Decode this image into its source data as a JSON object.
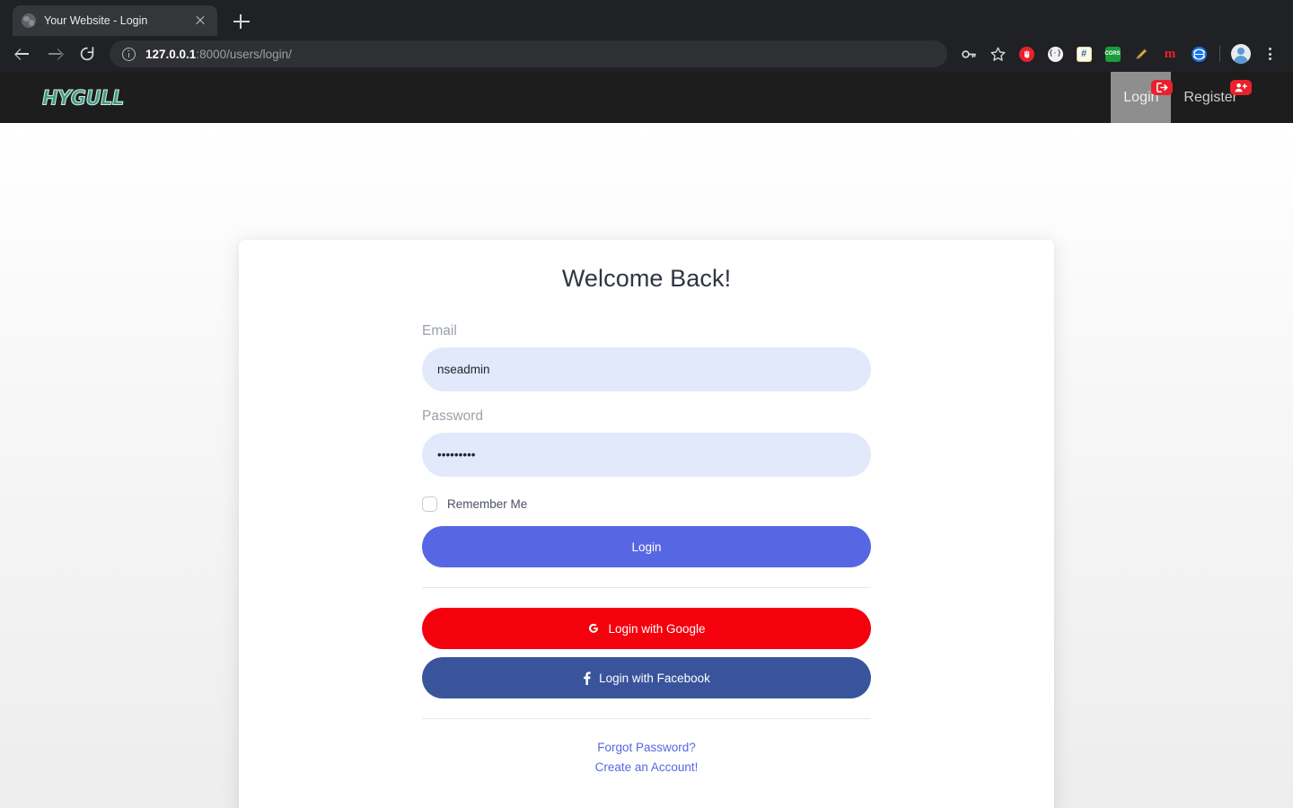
{
  "browser": {
    "tab": {
      "title": "Your Website - Login",
      "favicon": "globe-icon",
      "close": "close-icon"
    },
    "new_tab": "+",
    "nav": {
      "back": "back-arrow-icon",
      "forward": "forward-arrow-icon",
      "reload": "reload-icon"
    },
    "url": {
      "host": "127.0.0.1",
      "path": ":8000/users/login/",
      "security": "info-icon"
    },
    "toolbar_icons": [
      {
        "name": "password-key-icon",
        "glyph": "⚷",
        "color": "#d2d4d7",
        "bg": "transparent"
      },
      {
        "name": "bookmark-star-icon",
        "glyph": "☆",
        "color": "#d2d4d7",
        "bg": "transparent"
      },
      {
        "name": "ublock-origin-extension-icon",
        "glyph": "✋",
        "color": "#ffffff",
        "bg": "#e8212c"
      },
      {
        "name": "json-viewer-extension-icon",
        "glyph": "{·}",
        "color": "#3c3c3c",
        "bg": "#f1f1f1"
      },
      {
        "name": "notes-extension-icon",
        "glyph": "#",
        "color": "#2b6cb0",
        "bg": "#fdf6d8"
      },
      {
        "name": "cors-extension-icon",
        "glyph": "CORS",
        "color": "#ffffff",
        "bg": "#1a9c3c"
      },
      {
        "name": "marker-pen-extension-icon",
        "glyph": "✎",
        "color": "#e8a33d",
        "bg": "transparent"
      },
      {
        "name": "momentum-extension-icon",
        "glyph": "m",
        "color": "#e8212c",
        "bg": "transparent"
      },
      {
        "name": "globe-extension-icon",
        "glyph": "❄",
        "color": "#ffffff",
        "bg": "#1a73e8"
      }
    ],
    "profile": "profile-avatar-icon",
    "menu": "chrome-menu-icon"
  },
  "site_header": {
    "brand": "HYGULL",
    "nav_items": [
      {
        "label": "Login",
        "active": true,
        "badge_icon": "sign-in-icon"
      },
      {
        "label": "Register",
        "active": false,
        "badge_icon": "user-plus-icon"
      }
    ]
  },
  "login_card": {
    "title": "Welcome Back!",
    "email": {
      "label": "Email",
      "value": "nseadmin",
      "placeholder": "Email"
    },
    "password": {
      "label": "Password",
      "value": "•••••••••",
      "placeholder": "Password"
    },
    "remember_me": {
      "label": "Remember Me",
      "checked": false
    },
    "submit_button": "Login",
    "social": [
      {
        "label": "Login with Google",
        "icon": "google-g-icon",
        "color": "#f5010d"
      },
      {
        "label": "Login with Facebook",
        "icon": "facebook-f-icon",
        "color": "#3a549c"
      }
    ],
    "footer_links": [
      {
        "label": "Forgot Password?"
      },
      {
        "label": "Create an Account!"
      }
    ]
  },
  "colors": {
    "primary": "#5767e3",
    "google_red": "#f5010d",
    "facebook_blue": "#3a549c",
    "input_bg": "#e2e9fb",
    "navbar_bg": "#1d1d1d",
    "badge_red": "#e8212c",
    "brand_teal": "#3e9c82"
  }
}
